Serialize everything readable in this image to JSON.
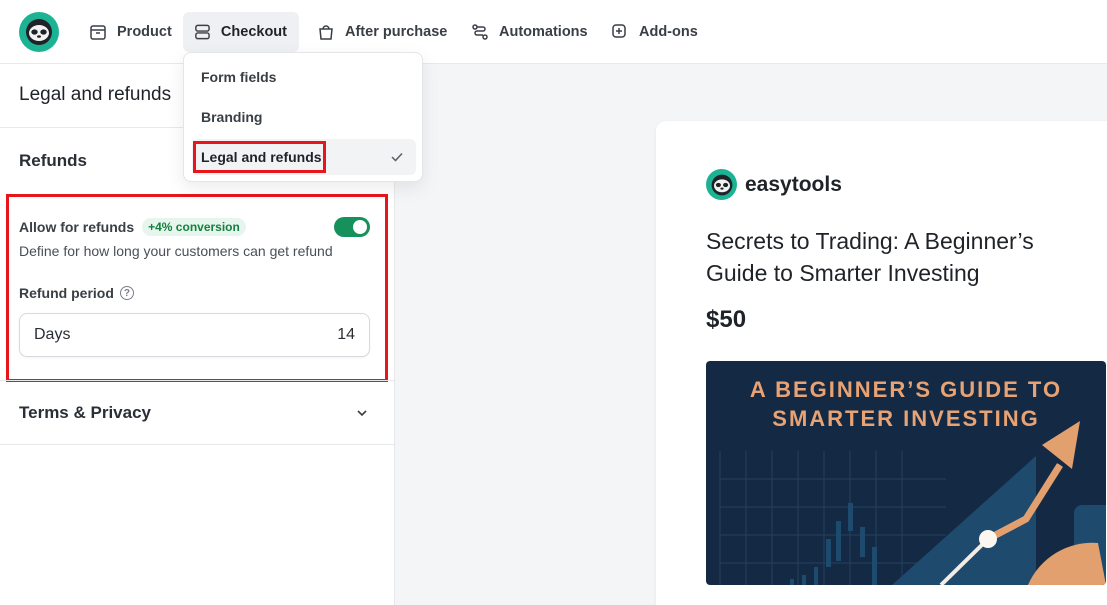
{
  "nav": {
    "tabs": [
      {
        "label": "Product",
        "icon": "box-icon"
      },
      {
        "label": "Checkout",
        "icon": "checkout-icon",
        "active": true
      },
      {
        "label": "After purchase",
        "icon": "bag-icon"
      },
      {
        "label": "Automations",
        "icon": "automation-icon"
      },
      {
        "label": "Add-ons",
        "icon": "addon-icon"
      }
    ]
  },
  "dropdown": {
    "items": [
      {
        "label": "Form fields"
      },
      {
        "label": "Branding"
      },
      {
        "label": "Legal and refunds",
        "selected": true
      }
    ]
  },
  "panel": {
    "title": "Legal and refunds",
    "refunds": {
      "title": "Refunds",
      "allow_label": "Allow for refunds",
      "badge": "+4% conversion",
      "toggle_on": true,
      "description": "Define for how long your customers can get refund",
      "period_label": "Refund period",
      "help_glyph": "?",
      "period_unit": "Days",
      "period_value": "14"
    },
    "terms": {
      "title": "Terms & Privacy"
    }
  },
  "preview": {
    "brand": "easytools",
    "product_title": "Secrets to Trading: A Beginner’s Guide to Smarter Investing",
    "price": "$50",
    "cover_line1": "A BEGINNER’S GUIDE TO",
    "cover_line2": "SMARTER INVESTING"
  },
  "colors": {
    "accent_green": "#16915b",
    "logo_teal": "#1bb394",
    "highlight_red": "#e8151b",
    "cover_bg": "#142a44",
    "cover_text": "#e8a273"
  }
}
